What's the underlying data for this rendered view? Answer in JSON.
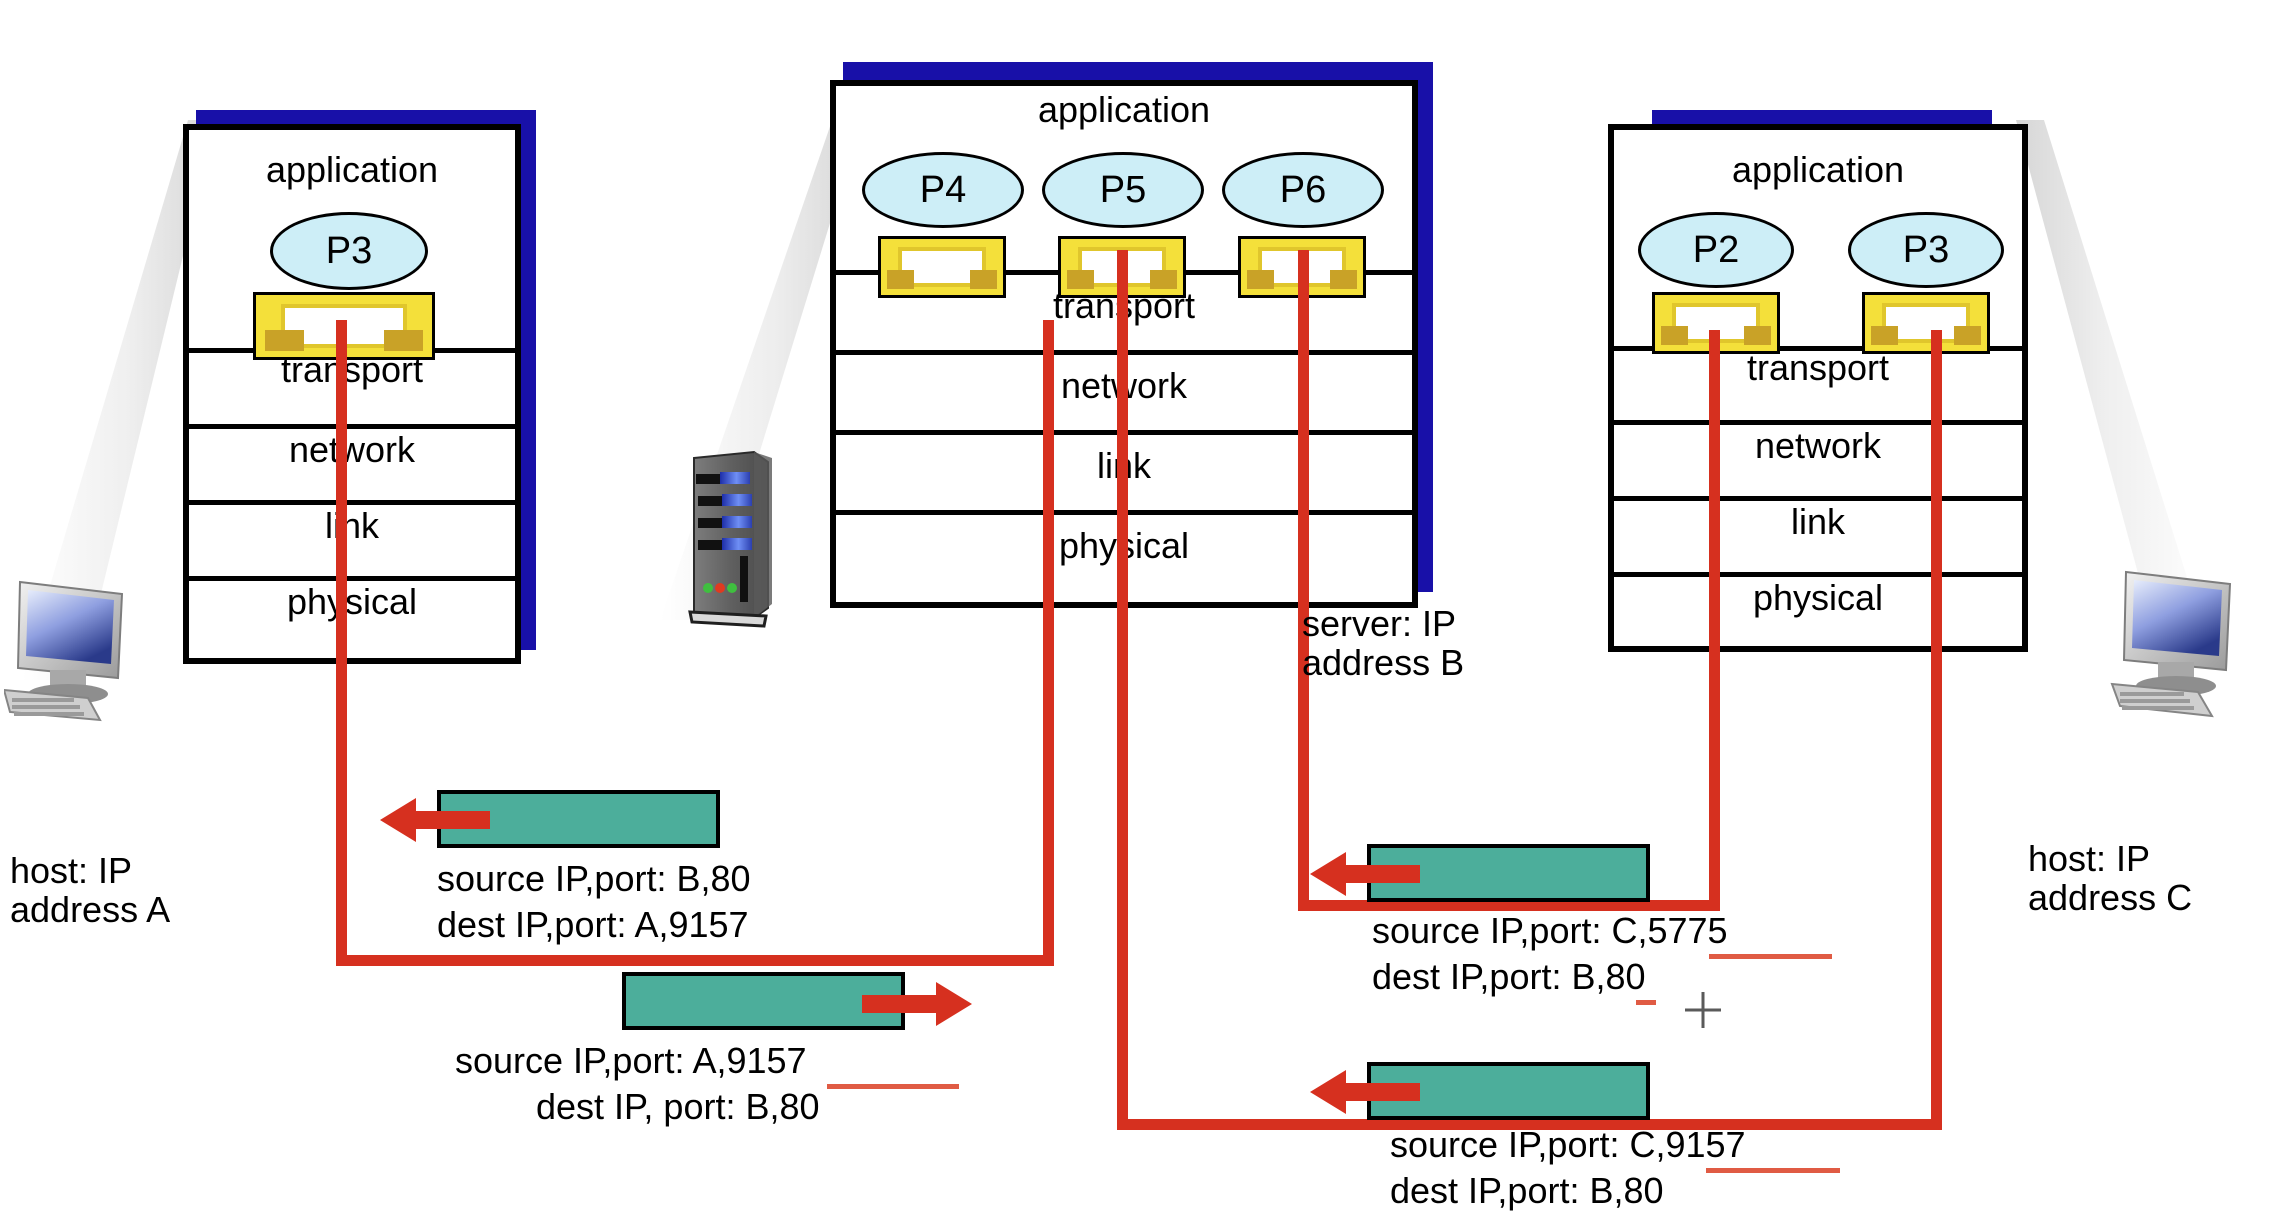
{
  "diagram": {
    "title": "Connection-oriented demultiplexing: threaded web server",
    "layer_labels": [
      "application",
      "transport",
      "network",
      "link",
      "physical"
    ]
  },
  "hosts": [
    {
      "id": "host-a",
      "role_label": "host: IP\naddress A",
      "layers": [
        "application",
        "transport",
        "network",
        "link",
        "physical"
      ],
      "processes": [
        "P3"
      ],
      "sockets": 1,
      "device_icon": "desktop-computer-icon"
    },
    {
      "id": "server-b",
      "role_label": "server: IP\naddress B",
      "layers": [
        "application",
        "transport",
        "network",
        "link",
        "physical"
      ],
      "processes": [
        "P4",
        "P5",
        "P6"
      ],
      "sockets": 3,
      "device_icon": "server-tower-icon"
    },
    {
      "id": "host-c",
      "role_label": "host: IP\naddress C",
      "layers": [
        "application",
        "transport",
        "network",
        "link",
        "physical"
      ],
      "processes": [
        "P2",
        "P3"
      ],
      "sockets": 2,
      "device_icon": "desktop-computer-icon"
    }
  ],
  "packets": [
    {
      "id": "pkt-b80-to-a9157",
      "direction": "left",
      "source_line": "source IP,port: B,80",
      "dest_line": "dest IP,port: A,9157",
      "underline": null
    },
    {
      "id": "pkt-a9157-to-b80",
      "direction": "right",
      "source_line": "source IP,port: A,9157",
      "dest_line": "dest IP, port: B,80",
      "underline": "A,9157"
    },
    {
      "id": "pkt-c5775-to-b80",
      "direction": "left",
      "source_line": "source IP,port: C,5775",
      "dest_line": "dest IP,port: B,80",
      "underline": "C,5775"
    },
    {
      "id": "pkt-c9157-to-b80",
      "direction": "left",
      "source_line": "source IP,port: C,9157",
      "dest_line": "dest IP,port: B,80",
      "underline": "C,9157"
    }
  ],
  "colors": {
    "socket_yellow": "#f4e03a",
    "socket_pin": "#c9a227",
    "process_blue": "#cdeef7",
    "packet_teal": "#4cae9b",
    "flow_red": "#d6301f",
    "underline_red": "#e05b44",
    "shadow_blue": "#1810a8",
    "background": "#ffffff"
  }
}
